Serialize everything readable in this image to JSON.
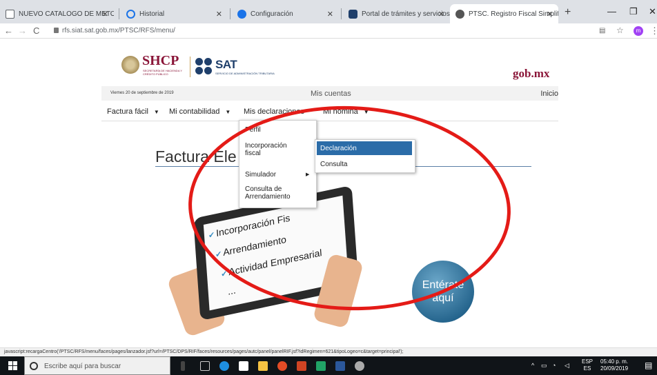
{
  "browser": {
    "tabs": [
      {
        "title": "NUEVO CATALOGO DE METODO",
        "icon": "document-icon",
        "active": false
      },
      {
        "title": "Historial",
        "icon": "history-icon",
        "active": false
      },
      {
        "title": "Configuración",
        "icon": "gear-icon",
        "active": false
      },
      {
        "title": "Portal de trámites y servicios -",
        "icon": "sat-icon",
        "active": false
      },
      {
        "title": "PTSC. Registro Fiscal Simplifica",
        "icon": "globe-icon",
        "active": true
      }
    ],
    "new_tab": "+",
    "address": "rfs.siat.sat.gob.mx/PTSC/RFS/menu/",
    "profile_initial": "m"
  },
  "page": {
    "shcp_logo": "SHCP",
    "shcp_sub": "SECRETARÍA DE HACIENDA Y CRÉDITO PÚBLICO",
    "sat_logo": "SAT",
    "sat_sub": "SERVICIO DE ADMINISTRACIÓN TRIBUTARIA",
    "gobmx": "gob.mx",
    "date": "Viernes 20 de septiembre de 2019",
    "center_title": "Mis cuentas",
    "home_link": "Inicio",
    "menu": [
      {
        "label": "Factura fácil",
        "caret": "▼"
      },
      {
        "label": "Mi contabilidad",
        "caret": "▼"
      },
      {
        "label": "Mis declaraciones",
        "caret": ""
      },
      {
        "label": "Mi nómina",
        "caret": "▼"
      }
    ],
    "dropdown": [
      "Perfil",
      "Incorporación fiscal",
      "Simulador",
      "Consulta de Arrendamiento"
    ],
    "submenu": [
      "Declaración",
      "Consulta"
    ],
    "heading": "Factura Ele",
    "tablet_lines": [
      "Incorporación Fis",
      "Arrendamiento",
      "Actividad Empresarial",
      "..."
    ],
    "enterate_line1": "Entérate",
    "enterate_line2": "aquí"
  },
  "status_url": "javascript:recargaCentro('/PTSC/RFS/menu/faces/pages/lanzador.jsf?url=/PTSC/DPS/RIF/faces/resources/pages/autc/panel/panelRIF.jsf?idRegimen=621&tipoLogeo=c&target=principal');",
  "taskbar": {
    "search_placeholder": "Escribe aquí para buscar",
    "lang_top": "ESP",
    "lang_bottom": "ES",
    "time": "05:40 p. m.",
    "date": "20/09/2019"
  },
  "colors": {
    "selected_item": "#2b6ca8",
    "annotation_ellipse": "#e41b17",
    "brand_burgundy": "#8a1538",
    "sat_blue": "#1f3f6b"
  }
}
